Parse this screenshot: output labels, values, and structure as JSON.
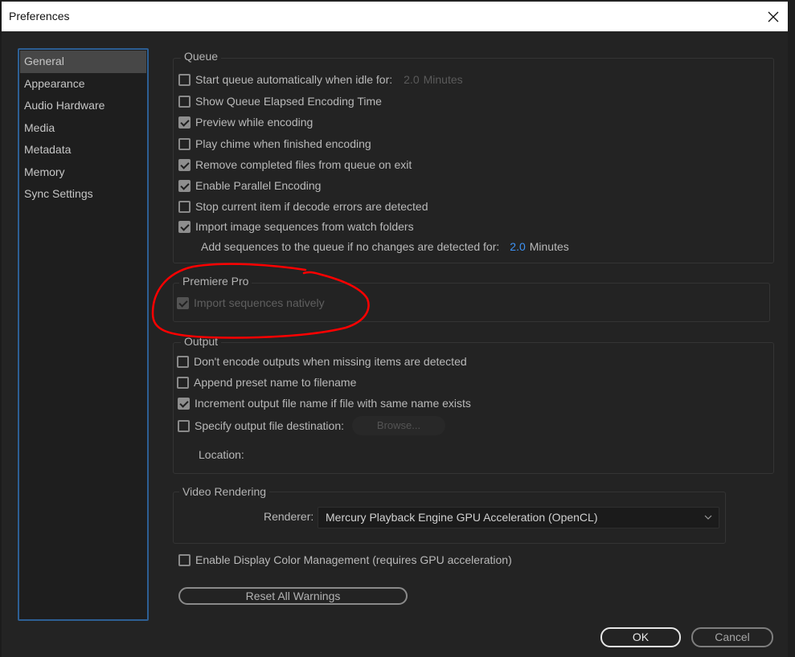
{
  "window": {
    "title": "Preferences",
    "close_icon": "close-icon"
  },
  "sidebar": {
    "items": [
      {
        "label": "General",
        "active": true
      },
      {
        "label": "Appearance",
        "active": false
      },
      {
        "label": "Audio Hardware",
        "active": false
      },
      {
        "label": "Media",
        "active": false
      },
      {
        "label": "Metadata",
        "active": false
      },
      {
        "label": "Memory",
        "active": false
      },
      {
        "label": "Sync Settings",
        "active": false
      }
    ]
  },
  "queue": {
    "title": "Queue",
    "start_auto": {
      "label": "Start queue automatically when idle for:",
      "checked": false,
      "value": "2.0",
      "unit": "Minutes"
    },
    "show_elapsed": {
      "label": "Show Queue Elapsed Encoding Time",
      "checked": false
    },
    "preview": {
      "label": "Preview while encoding",
      "checked": true
    },
    "chime": {
      "label": "Play chime when finished encoding",
      "checked": false
    },
    "remove_completed": {
      "label": "Remove completed files from queue on exit",
      "checked": true
    },
    "parallel": {
      "label": "Enable Parallel Encoding",
      "checked": true
    },
    "stop_decode": {
      "label": "Stop current item if decode errors are detected",
      "checked": false
    },
    "import_sequences": {
      "label": "Import image sequences from watch folders",
      "checked": true
    },
    "add_sequences": {
      "label": "Add sequences to the queue if no changes are detected for:",
      "value": "2.0",
      "unit": "Minutes"
    }
  },
  "premiere": {
    "title": "Premiere Pro",
    "import_natively": {
      "label": "Import sequences natively",
      "checked": true,
      "disabled": true
    }
  },
  "output": {
    "title": "Output",
    "dont_encode": {
      "label": "Don't encode outputs when missing items are detected",
      "checked": false
    },
    "append_preset": {
      "label": "Append preset name to filename",
      "checked": false
    },
    "increment": {
      "label": "Increment output file name if file with same name exists",
      "checked": true
    },
    "specify_dest": {
      "label": "Specify output file destination:",
      "checked": false
    },
    "browse_label": "Browse...",
    "location_label": "Location:"
  },
  "video_rendering": {
    "title": "Video Rendering",
    "renderer_label": "Renderer:",
    "renderer_value": "Mercury Playback Engine GPU Acceleration (OpenCL)"
  },
  "color_mgmt": {
    "label": "Enable Display Color Management (requires GPU acceleration)",
    "checked": false
  },
  "buttons": {
    "reset": "Reset All Warnings",
    "ok": "OK",
    "cancel": "Cancel"
  },
  "colors": {
    "accent_blue": "#3e93f5",
    "sidebar_border": "#2d5f94",
    "annotation_red": "#ff0000"
  }
}
